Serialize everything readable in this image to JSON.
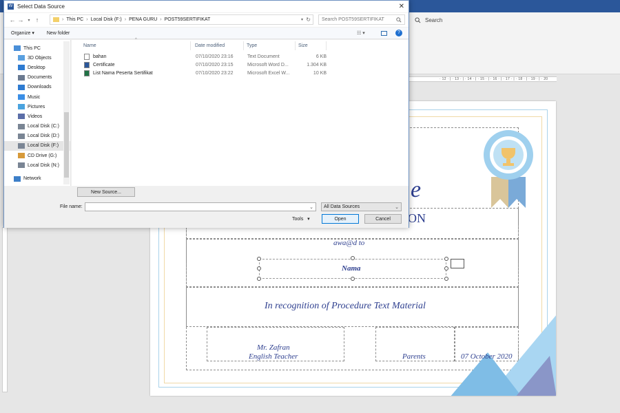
{
  "word": {
    "search_label": "Search",
    "ruler_marks": "· 12 · | · 13 · | · 14 · | · 15 · | · 16 · | · 17 · | · 18 · | · 19 · | · 20"
  },
  "certificate": {
    "title_partial": "e",
    "subtitle_partial": "ON",
    "awarded_to": "awa@d to",
    "name": "Nama",
    "recognition": "In recognition of Procedure Text Material",
    "signer_name": "Mr. Zafran",
    "signer_role": "English Teacher",
    "parents": "Parents",
    "date": "07 October 2020"
  },
  "dialog": {
    "title": "Select Data Source",
    "breadcrumbs": [
      "This PC",
      "Local Disk (F:)",
      "PENA GURU",
      "POST59SERTIFIKAT"
    ],
    "search_placeholder": "Search POST59SERTIFIKAT",
    "toolbar": {
      "organize": "Organize",
      "new_folder": "New folder"
    },
    "nav_items": [
      {
        "label": "This PC",
        "icon": "computer-icon"
      },
      {
        "label": "3D Objects",
        "icon": "cube-folder-icon"
      },
      {
        "label": "Desktop",
        "icon": "desktop-folder-icon"
      },
      {
        "label": "Documents",
        "icon": "documents-folder-icon"
      },
      {
        "label": "Downloads",
        "icon": "downloads-folder-icon"
      },
      {
        "label": "Music",
        "icon": "music-folder-icon"
      },
      {
        "label": "Pictures",
        "icon": "pictures-folder-icon"
      },
      {
        "label": "Videos",
        "icon": "videos-folder-icon"
      },
      {
        "label": "Local Disk (C:)",
        "icon": "drive-icon"
      },
      {
        "label": "Local Disk (D:)",
        "icon": "drive-icon"
      },
      {
        "label": "Local Disk (F:)",
        "icon": "drive-icon"
      },
      {
        "label": "CD Drive (G:)",
        "icon": "cd-drive-icon"
      },
      {
        "label": "Local Disk (N:)",
        "icon": "drive-icon"
      },
      {
        "label": "Network",
        "icon": "network-icon"
      }
    ],
    "columns": {
      "name": "Name",
      "date": "Date modified",
      "type": "Type",
      "size": "Size"
    },
    "files": [
      {
        "name": "bahan",
        "date": "07/10/2020 23:16",
        "type": "Text Document",
        "size": "6 KB",
        "icon": "text-file-icon"
      },
      {
        "name": "Certificate",
        "date": "07/10/2020 23:15",
        "type": "Microsoft Word D...",
        "size": "1.304 KB",
        "icon": "word-file-icon"
      },
      {
        "name": "List Nama Peserta Sertifikat",
        "date": "07/10/2020 23:22",
        "type": "Microsoft Excel W...",
        "size": "10 KB",
        "icon": "excel-file-icon"
      }
    ],
    "new_source": "New Source...",
    "file_name_label": "File name:",
    "file_name_value": "",
    "file_type": "All Data Sources",
    "tools": "Tools",
    "open": "Open",
    "cancel": "Cancel"
  }
}
